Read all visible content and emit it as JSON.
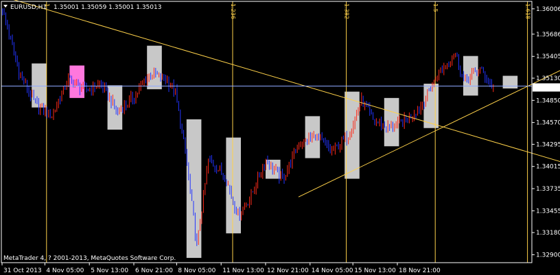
{
  "window": {
    "symbol_label": "EURUSD,H1",
    "ohlc": "1.35001 1.35059 1.35001 1.35013",
    "copyright": "MetaTrader 4, ? 2001-2013, MetaQuotes Software Corp."
  },
  "colors": {
    "background": "#000000",
    "grid": "#ffffff",
    "bull": "#ff2a1a",
    "bear": "#2233ff",
    "box": "#c8c8c8",
    "box_highlight": "#ff77dd",
    "fib": "#ffd24a",
    "current_price_bg": "#ffffff",
    "current_price_text": "#000000"
  },
  "chart_data": {
    "type": "candlestick",
    "ylim": [
      1.328,
      1.361
    ],
    "y_ticks": [
      "1.36006",
      "1.35686",
      "1.35405",
      "1.35130",
      "1.34850",
      "1.34570",
      "1.34295",
      "1.34015",
      "1.33735",
      "1.33455",
      "1.33180",
      "1.32900"
    ],
    "current_price": "1.35013",
    "x_ticks": [
      "31 Oct 2013",
      "4 Nov 05:00",
      "5 Nov 13:00",
      "6 Nov 21:00",
      "8 Nov 05:00",
      "11 Nov 13:00",
      "12 Nov 21:00",
      "14 Nov 05:00",
      "15 Nov 13:00",
      "18 Nov 21:00"
    ],
    "fib_time_zones": [
      "1",
      "1.236",
      "1.382",
      "1.5",
      "1.618"
    ],
    "anchors": [
      [
        0,
        1.36
      ],
      [
        10,
        1.352
      ],
      [
        20,
        1.348
      ],
      [
        30,
        1.3465
      ],
      [
        40,
        1.3512
      ],
      [
        50,
        1.3498
      ],
      [
        60,
        1.3505
      ],
      [
        70,
        1.347
      ],
      [
        80,
        1.349
      ],
      [
        90,
        1.352
      ],
      [
        100,
        1.351
      ],
      [
        105,
        1.3495
      ],
      [
        112,
        1.3405
      ],
      [
        118,
        1.33
      ],
      [
        125,
        1.341
      ],
      [
        135,
        1.339
      ],
      [
        143,
        1.334
      ],
      [
        150,
        1.336
      ],
      [
        160,
        1.341
      ],
      [
        170,
        1.3385
      ],
      [
        180,
        1.343
      ],
      [
        190,
        1.344
      ],
      [
        200,
        1.342
      ],
      [
        210,
        1.344
      ],
      [
        218,
        1.3485
      ],
      [
        225,
        1.346
      ],
      [
        235,
        1.345
      ],
      [
        245,
        1.346
      ],
      [
        255,
        1.348
      ],
      [
        265,
        1.352
      ],
      [
        275,
        1.3545
      ],
      [
        280,
        1.351
      ],
      [
        290,
        1.3525
      ],
      [
        298,
        1.35
      ]
    ],
    "boxes": [
      {
        "x0": 18,
        "x1": 27,
        "hi": 1.35316,
        "lo": 1.3476,
        "highlight": false
      },
      {
        "x0": 41,
        "x1": 50,
        "hi": 1.3529,
        "lo": 1.3488,
        "highlight": true
      },
      {
        "x0": 64,
        "x1": 73,
        "hi": 1.3504,
        "lo": 1.3448,
        "highlight": false
      },
      {
        "x0": 88,
        "x1": 97,
        "hi": 1.3554,
        "lo": 1.3499,
        "highlight": false
      },
      {
        "x0": 112,
        "x1": 121,
        "hi": 1.3461,
        "lo": 1.3286,
        "highlight": false
      },
      {
        "x0": 136,
        "x1": 145,
        "hi": 1.3438,
        "lo": 1.3317,
        "highlight": false
      },
      {
        "x0": 160,
        "x1": 169,
        "hi": 1.341,
        "lo": 1.3386,
        "highlight": false
      },
      {
        "x0": 184,
        "x1": 193,
        "hi": 1.3465,
        "lo": 1.3412,
        "highlight": false
      },
      {
        "x0": 208,
        "x1": 217,
        "hi": 1.3496,
        "lo": 1.3386,
        "highlight": false
      },
      {
        "x0": 232,
        "x1": 241,
        "hi": 1.3488,
        "lo": 1.3427,
        "highlight": false
      },
      {
        "x0": 256,
        "x1": 265,
        "hi": 1.3506,
        "lo": 1.345,
        "highlight": false
      },
      {
        "x0": 280,
        "x1": 289,
        "hi": 1.3541,
        "lo": 1.3491,
        "highlight": false
      },
      {
        "x0": 304,
        "x1": 313,
        "hi": 1.3516,
        "lo": 1.35,
        "highlight": false
      }
    ],
    "trendlines": [
      {
        "from": [
          -22,
          1.363
        ],
        "to": [
          400,
          1.337
        ]
      },
      {
        "from": [
          180,
          1.3363
        ],
        "to": [
          380,
          1.3564
        ]
      }
    ],
    "horizontal_lines": [
      1.3503
    ]
  }
}
